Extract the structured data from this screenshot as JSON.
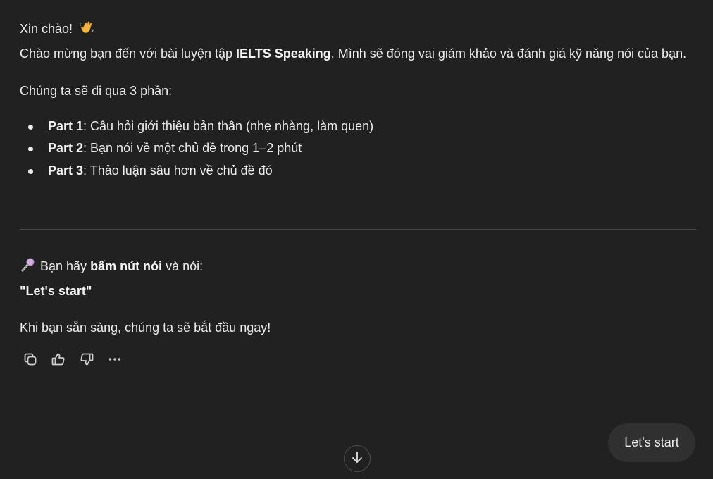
{
  "message": {
    "greeting": "Xin chào!",
    "greeting_icon": "waving-hand-icon",
    "intro_pre": "Chào mừng bạn đến với bài luyện tập ",
    "intro_bold": "IELTS Speaking",
    "intro_post": ". Mình sẽ đóng vai giám khảo và đánh giá kỹ năng nói của bạn.",
    "parts_intro": "Chúng ta sẽ đi qua 3 phần:",
    "parts": [
      {
        "label": "Part 1",
        "text": ": Câu hỏi giới thiệu bản thân (nhẹ nhàng, làm quen)"
      },
      {
        "label": "Part 2",
        "text": ": Bạn nói về một chủ đề trong 1–2 phút"
      },
      {
        "label": "Part 3",
        "text": ": Thảo luận sâu hơn về chủ đề đó"
      }
    ],
    "instruction_icon": "microphone-icon",
    "instruction_pre": " Bạn hãy ",
    "instruction_bold": "bấm nút nói",
    "instruction_post": " và nói:",
    "quote": "\"Let's start\"",
    "ready_line": "Khi bạn sẵn sàng, chúng ta sẽ bắt đầu ngay!"
  },
  "actions": {
    "icons": [
      "copy-icon",
      "thumbs-up-icon",
      "thumbs-down-icon",
      "more-icon"
    ]
  },
  "suggestion": {
    "label": "Let's start"
  },
  "scroll": {
    "icon": "arrow-down-icon"
  },
  "colors": {
    "background": "#212121",
    "text": "#ececec",
    "pill": "#303030"
  }
}
